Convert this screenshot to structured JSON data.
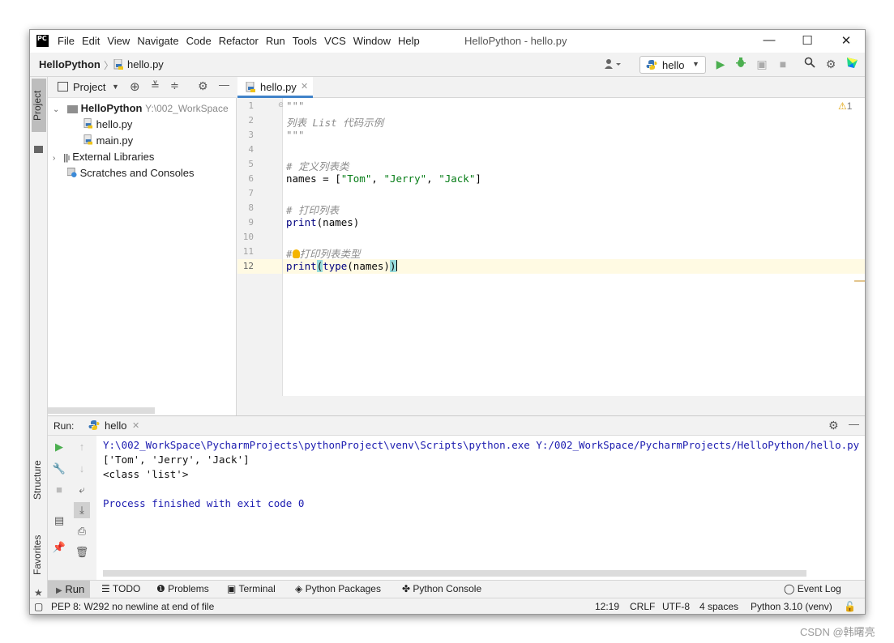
{
  "window": {
    "title": "HelloPython - hello.py",
    "menu": [
      "File",
      "Edit",
      "View",
      "Navigate",
      "Code",
      "Refactor",
      "Run",
      "Tools",
      "VCS",
      "Window",
      "Help"
    ],
    "logo_text": "PC"
  },
  "navbar": {
    "project": "HelloPython",
    "separator": "〉",
    "file": "hello.py",
    "run_config": "hello"
  },
  "stripe": {
    "project": "Project",
    "structure": "Structure",
    "favorites": "Favorites"
  },
  "project_panel": {
    "title": "Project",
    "root": "HelloPython",
    "root_path": "Y:\\002_WorkSpace",
    "files": [
      "hello.py",
      "main.py"
    ],
    "external": "External Libraries",
    "scratches": "Scratches and Consoles"
  },
  "editor": {
    "tab": "hello.py",
    "warnings": "1",
    "line_numbers": [
      "1",
      "2",
      "3",
      "4",
      "5",
      "6",
      "7",
      "8",
      "9",
      "10",
      "11",
      "12"
    ],
    "lines": {
      "l1": "\"\"\"",
      "l2": "列表 List 代码示例",
      "l3": "\"\"\"",
      "l5": "# 定义列表类",
      "l6_a": "names = [",
      "l6_s1": "\"Tom\"",
      "l6_c1": ", ",
      "l6_s2": "\"Jerry\"",
      "l6_c2": ", ",
      "l6_s3": "\"Jack\"",
      "l6_end": "]",
      "l8": "# 打印列表",
      "l9_fn": "print",
      "l9_rest": "(names)",
      "l11_a": "#",
      "l11_b": "打印列表类型",
      "l12_fn": "print",
      "l12_open": "(",
      "l12_fn2": "type",
      "l12_mid": "(names)",
      "l12_close": ")"
    }
  },
  "run_panel": {
    "label": "Run:",
    "tab": "hello",
    "output": [
      "Y:\\002_WorkSpace\\PycharmProjects\\pythonProject\\venv\\Scripts\\python.exe Y:/002_WorkSpace/PycharmProjects/HelloPython/hello.py",
      "['Tom', 'Jerry', 'Jack']",
      "<class 'list'>",
      "",
      "Process finished with exit code 0"
    ]
  },
  "tool_windows": [
    "Run",
    "TODO",
    "Problems",
    "Terminal",
    "Python Packages",
    "Python Console"
  ],
  "event_log": "Event Log",
  "status": {
    "message": "PEP 8: W292 no newline at end of file",
    "position": "12:19",
    "line_sep": "CRLF",
    "encoding": "UTF-8",
    "indent": "4 spaces",
    "interpreter": "Python 3.10 (venv)"
  },
  "watermark": "CSDN @韩曙亮",
  "colors": {
    "accent": "#4083c9",
    "run_green": "#4caf50",
    "string_green": "#067d17",
    "comment_gray": "#8c8c8c",
    "console_blue": "#1c1cb0"
  }
}
